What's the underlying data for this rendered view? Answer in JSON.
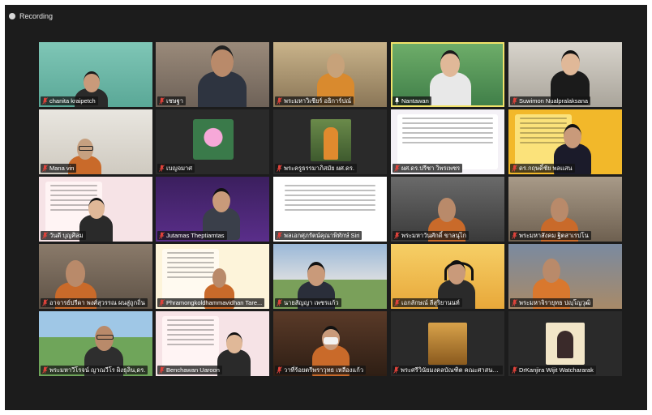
{
  "recording": {
    "label": "Recording"
  },
  "colors": {
    "background": "#1c1c1c",
    "active_border": "#f1e26a",
    "muted_mic": "#e0433b"
  },
  "participants": [
    {
      "name": "chanita kraipetch",
      "muted": true,
      "mic_icon": "mic-muted-icon"
    },
    {
      "name": "เชษฐา",
      "muted": true,
      "mic_icon": "mic-muted-icon"
    },
    {
      "name": "พระมหาวิเชียร์ อธิการ์ปณ์",
      "muted": true,
      "mic_icon": "mic-muted-icon"
    },
    {
      "name": "Nantawan",
      "muted": false,
      "active_speaker": true,
      "mic_icon": "mic-active-icon"
    },
    {
      "name": "Suwimon Nualpralaksana",
      "muted": true,
      "mic_icon": "mic-muted-icon"
    },
    {
      "name": "Mana vin",
      "muted": true,
      "mic_icon": "mic-muted-icon"
    },
    {
      "name": "เบญจมาศ",
      "muted": true,
      "mic_icon": "mic-muted-icon"
    },
    {
      "name": "พระครูธรรมาภิสมัย ผศ.ดร.",
      "muted": true,
      "mic_icon": "mic-muted-icon"
    },
    {
      "name": "ผศ.ดร.ปรีชา วิพรเพชร",
      "muted": true,
      "mic_icon": "mic-muted-icon"
    },
    {
      "name": "ดร.กฤษดิ์ชัย พลแสน",
      "muted": true,
      "mic_icon": "mic-muted-icon"
    },
    {
      "name": "วันดี บุญศิลม",
      "muted": true,
      "mic_icon": "mic-muted-icon"
    },
    {
      "name": "Jutamas Theptiamtas",
      "muted": true,
      "mic_icon": "mic-muted-icon"
    },
    {
      "name": "พลเอกศุภรัตน์คุณาพิทักษ์ Siri",
      "muted": true,
      "mic_icon": "mic-muted-icon"
    },
    {
      "name": "พระมหาวันศักดิ์ ขาลนุไก",
      "muted": true,
      "mic_icon": "mic-muted-icon"
    },
    {
      "name": "พระมหาสังคม ฐิตสาเรปโน",
      "muted": true,
      "mic_icon": "mic-muted-icon"
    },
    {
      "name": "อาจารย์ปรีดา พงศ์สุวรรณ ผนสู่ถูกถิ่น",
      "muted": true,
      "mic_icon": "mic-muted-icon"
    },
    {
      "name": "Phramongkoldhammavidhan Tare...",
      "muted": true,
      "mic_icon": "mic-muted-icon"
    },
    {
      "name": "นายสัญญา เพชรแก้ว",
      "muted": true,
      "mic_icon": "mic-muted-icon"
    },
    {
      "name": "เอกลักษณ์ ลีสุริยานนท์",
      "muted": true,
      "mic_icon": "mic-muted-icon"
    },
    {
      "name": "พระมหาจิรายุทธ ปญฺโญวุฒิ",
      "muted": true,
      "mic_icon": "mic-muted-icon"
    },
    {
      "name": "พระมหาวีโรจน์ ญาณวีโร ผิงธุลิน,ดร.",
      "muted": true,
      "mic_icon": "mic-muted-icon"
    },
    {
      "name": "Benchawan Uaroon",
      "muted": true,
      "mic_icon": "mic-muted-icon"
    },
    {
      "name": "วาที่ร้อยตรีพราวุทธ เหลืองแก้ว",
      "muted": true,
      "mic_icon": "mic-muted-icon"
    },
    {
      "name": "พระศรีวินัยมงคลบัณฑิต คณะศาสนาและปรั...",
      "muted": true,
      "mic_icon": "mic-muted-icon"
    },
    {
      "name": "DrKanjira Wijit Watchararak",
      "muted": true,
      "mic_icon": "mic-muted-icon"
    }
  ]
}
